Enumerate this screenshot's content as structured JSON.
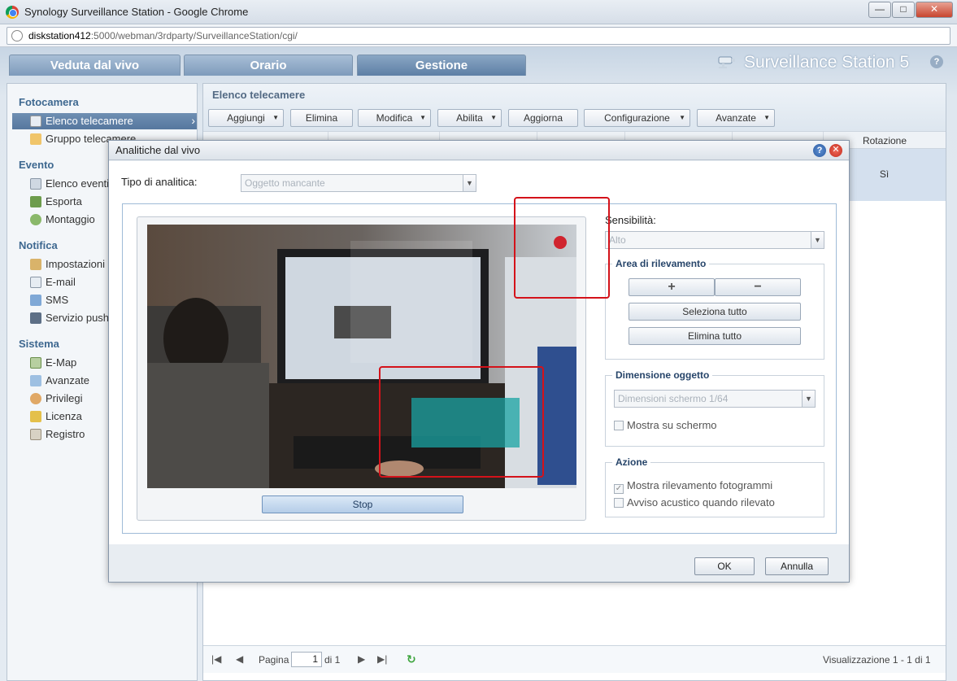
{
  "window": {
    "title": "Synology Surveillance Station - Google Chrome",
    "min": "—",
    "max": "□",
    "close": "✕"
  },
  "url": {
    "host": "diskstation412",
    "path": ":5000/webman/3rdparty/SurveillanceStation/cgi/"
  },
  "tabs": {
    "live": "Veduta dal vivo",
    "schedule": "Orario",
    "management": "Gestione"
  },
  "brand": {
    "name": "Surveillance Station 5",
    "help": "?"
  },
  "sidebar": {
    "sections": {
      "camera": "Fotocamera",
      "event": "Evento",
      "notify": "Notifica",
      "system": "Sistema"
    },
    "items": [
      {
        "label": "Elenco telecamere"
      },
      {
        "label": "Gruppo telecamere"
      },
      {
        "label": "Elenco eventi"
      },
      {
        "label": "Esporta"
      },
      {
        "label": "Montaggio"
      },
      {
        "label": "Impostazioni"
      },
      {
        "label": "E-mail"
      },
      {
        "label": "SMS"
      },
      {
        "label": "Servizio push"
      },
      {
        "label": "E-Map"
      },
      {
        "label": "Avanzate"
      },
      {
        "label": "Privilegi"
      },
      {
        "label": "Licenza"
      },
      {
        "label": "Registro"
      }
    ]
  },
  "main": {
    "title": "Elenco telecamere",
    "toolbar": {
      "add": "Aggiungi",
      "delete": "Elimina",
      "edit": "Modifica",
      "enable": "Abilita",
      "refresh": "Aggiorna",
      "config": "Configurazione",
      "advanced": "Avanzate"
    },
    "columns": {
      "rotation": "Rotazione"
    },
    "row": {
      "rotation": "Sì"
    },
    "pager": {
      "page_label": "Pagina",
      "page_value": "1",
      "of_label": "di 1",
      "display": "Visualizzazione 1 - 1 di 1"
    }
  },
  "dialog": {
    "title": "Analitiche dal vivo",
    "analytics_type_label": "Tipo di analitica:",
    "analytics_type_value": "Oggetto mancante",
    "stop": "Stop",
    "sensitivity_label": "Sensibilità:",
    "sensitivity_value": "Alto",
    "detection_area": {
      "legend": "Area di rilevamento",
      "select_all": "Seleziona tutto",
      "clear_all": "Elimina tutto"
    },
    "object_size": {
      "legend": "Dimensione oggetto",
      "value": "Dimensioni schermo 1/64",
      "show_on_screen": "Mostra su schermo"
    },
    "action": {
      "legend": "Azione",
      "show_frames": "Mostra rilevamento fotogrammi",
      "beep": "Avviso acustico quando rilevato"
    },
    "ok": "OK",
    "cancel": "Annulla"
  },
  "colors": {
    "accent": "#56779e",
    "overlay": "#d4121a"
  }
}
